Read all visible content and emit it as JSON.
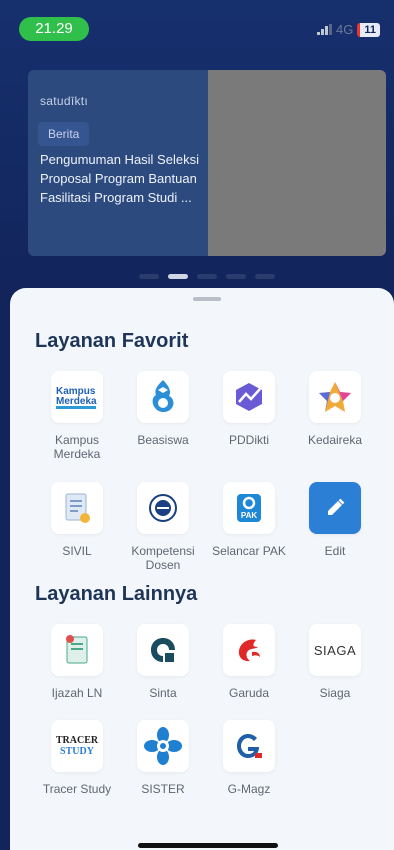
{
  "status_bar": {
    "time": "21.29",
    "network": "4G",
    "battery": "11"
  },
  "banner": {
    "brand": "satudīktı",
    "tag": "Berita",
    "headline": "Pengumuman Hasil Seleksi Proposal Program Bantuan Fasilitasi Program Studi ...",
    "page_indicator": {
      "count": 5,
      "active_index": 1
    }
  },
  "favorites": {
    "title": "Layanan Favorit",
    "items": [
      {
        "label": "Kampus Merdeka",
        "icon": "kampus-merdeka-logo-icon"
      },
      {
        "label": "Beasiswa",
        "icon": "beasiswa-logo-icon"
      },
      {
        "label": "PDDikti",
        "icon": "pddikti-logo-icon"
      },
      {
        "label": "Kedaireka",
        "icon": "kedaireka-logo-icon"
      },
      {
        "label": "SIVIL",
        "icon": "sivil-document-icon"
      },
      {
        "label": "Kompetensi Dosen",
        "icon": "kompetensi-dosen-seal-icon"
      },
      {
        "label": "Selancar PAK",
        "icon": "selancar-pak-icon"
      },
      {
        "label": "Edit",
        "icon": "pencil-icon"
      }
    ]
  },
  "others": {
    "title": "Layanan Lainnya",
    "items": [
      {
        "label": "Ijazah LN",
        "icon": "ijazah-certificate-icon"
      },
      {
        "label": "Sinta",
        "icon": "sinta-logo-icon"
      },
      {
        "label": "Garuda",
        "icon": "garuda-logo-icon"
      },
      {
        "label": "Siaga",
        "icon": "siaga-wordmark-icon",
        "wordmark": "SIAGA"
      },
      {
        "label": "Tracer Study",
        "icon": "tracer-study-logo-icon",
        "wordmark_top": "TRACER",
        "wordmark_bottom": "STUDY"
      },
      {
        "label": "SISTER",
        "icon": "sister-logo-icon"
      },
      {
        "label": "G-Magz",
        "icon": "g-magz-logo-icon"
      }
    ]
  },
  "logo_text": {
    "kampus": "Kampus",
    "merdeka": "Merdeka",
    "pak": "PAK"
  },
  "colors": {
    "accent": "#2b7fd4",
    "header": "#12245a",
    "sheet": "#f3f7fb",
    "title": "#1e3558",
    "time_pill": "#2fbf4a"
  }
}
